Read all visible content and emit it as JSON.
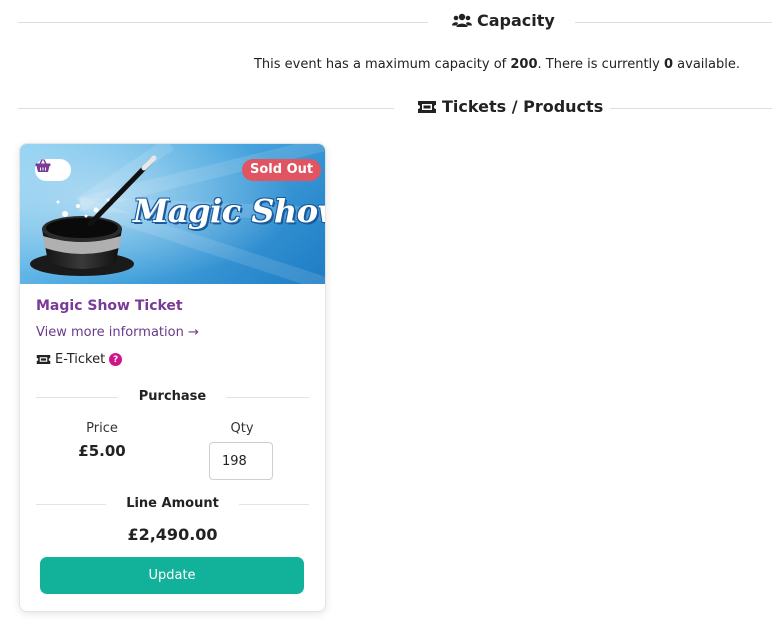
{
  "capacity_section": {
    "title": "Capacity",
    "icon": "users-icon",
    "text_prefix": "This event has a maximum capacity of ",
    "max_capacity": "200",
    "text_middle": ". There is currently ",
    "available": "0",
    "text_suffix": " available."
  },
  "tickets_section": {
    "title": "Tickets / Products",
    "icon": "ticket-icon"
  },
  "product": {
    "banner_title": "Magic Show",
    "status_badge": "Sold Out",
    "name": "Magic Show Ticket",
    "more_info_link": "View more information →",
    "delivery_type": "E-Ticket",
    "help_mark": "?",
    "purchase_heading": "Purchase",
    "price_label": "Price",
    "price": "£5.00",
    "qty_label": "Qty",
    "qty": "198",
    "line_amount_heading": "Line Amount",
    "line_amount": "£2,490.00",
    "update_button": "Update"
  },
  "colors": {
    "accent": "#12b29a",
    "product_name": "#7a3a97",
    "sold_out": "#e05561",
    "help": "#d0148a"
  }
}
